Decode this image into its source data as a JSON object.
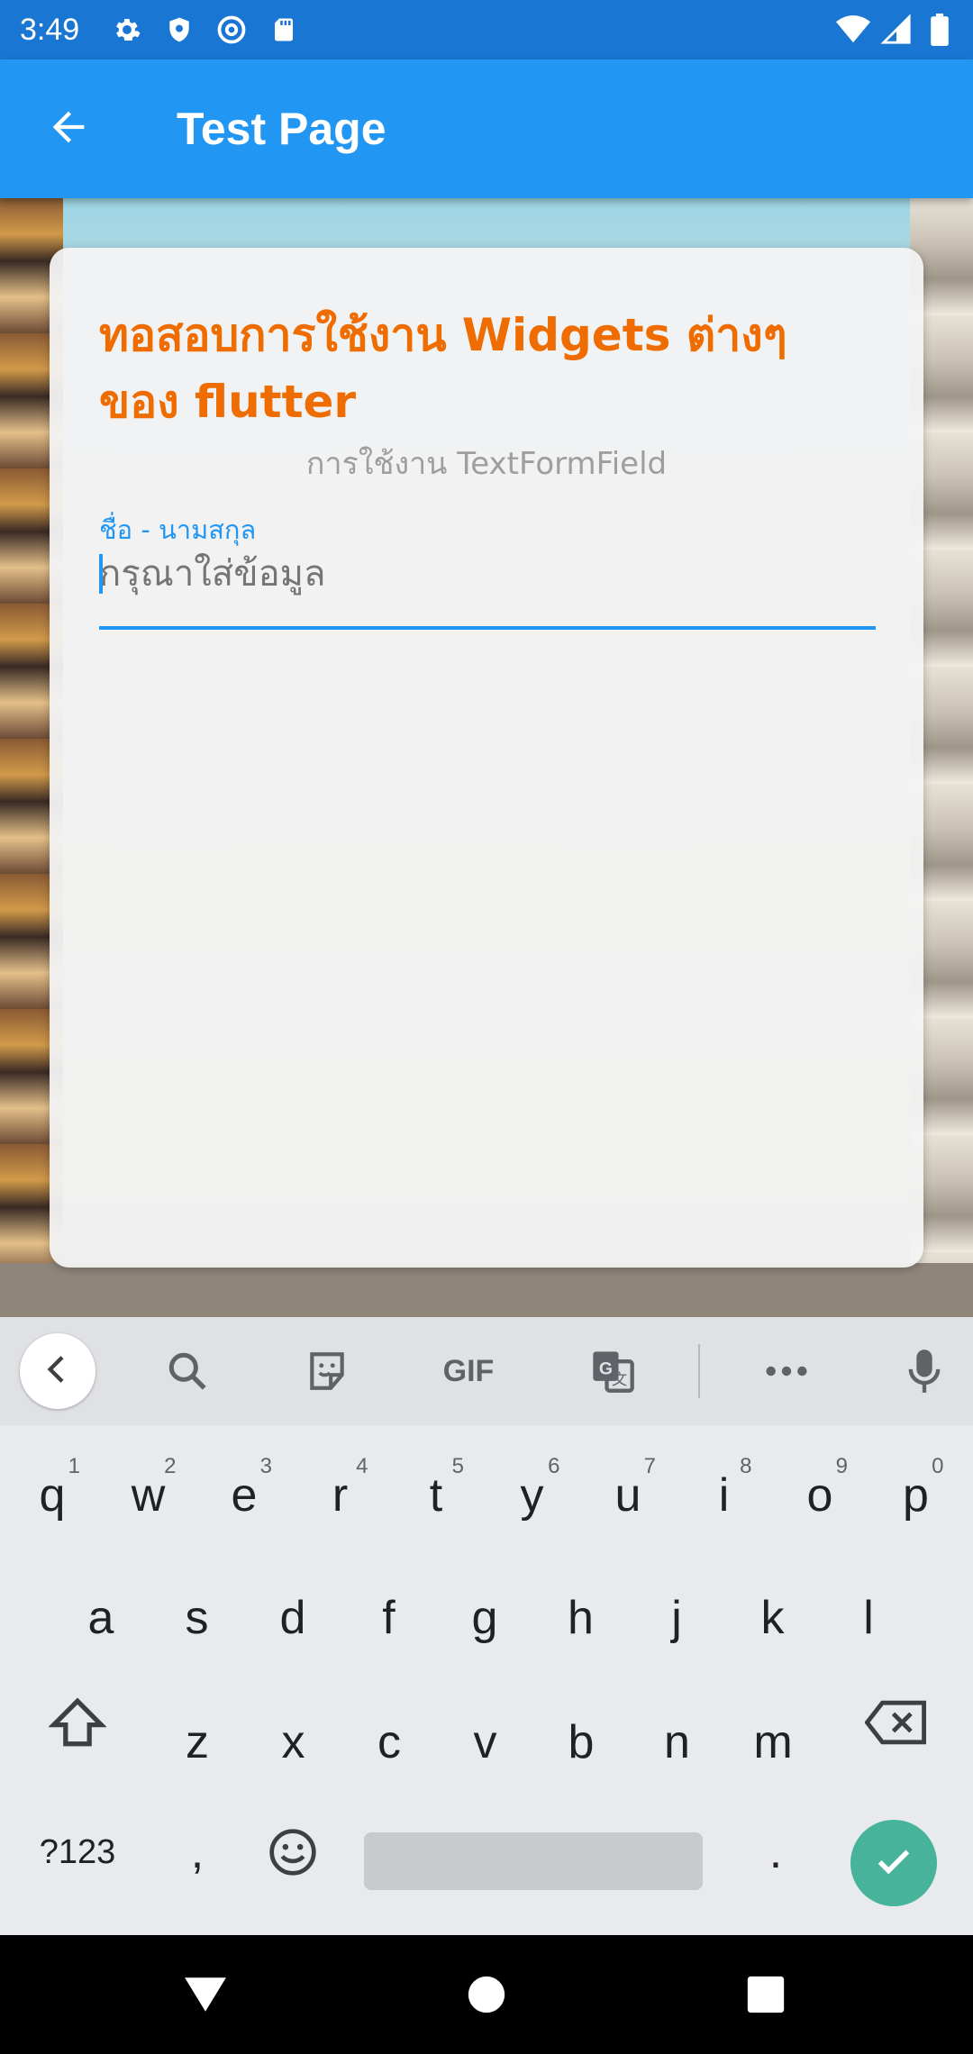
{
  "status_bar": {
    "time": "3:49",
    "left_icons": [
      "settings-icon",
      "shield-icon",
      "at-sign-icon",
      "sd-card-icon"
    ],
    "right_icons": [
      "wifi-icon",
      "signal-icon",
      "battery-icon"
    ]
  },
  "app_bar": {
    "title": "Test Page",
    "back_icon": "arrow-back-icon"
  },
  "card": {
    "title": "ทอสอบการใช้งาน Widgets ต่างๆ ของ flutter",
    "subtitle": "การใช้งาน TextFormField",
    "field": {
      "label": "ชื่อ - นามสกุล",
      "placeholder": "กรุณาใส่ข้อมูล",
      "value": ""
    }
  },
  "colors": {
    "status_bar": "#1976d2",
    "app_bar": "#2196f3",
    "title": "#ef6c00",
    "accent": "#2196f3",
    "enter_key": "#47b39b"
  },
  "keyboard": {
    "toolbar": [
      "collapse-icon",
      "search-icon",
      "sticker-icon",
      "gif-icon",
      "translate-icon",
      "more-icon",
      "mic-icon"
    ],
    "gif_label": "GIF",
    "row1": [
      {
        "k": "q",
        "n": "1"
      },
      {
        "k": "w",
        "n": "2"
      },
      {
        "k": "e",
        "n": "3"
      },
      {
        "k": "r",
        "n": "4"
      },
      {
        "k": "t",
        "n": "5"
      },
      {
        "k": "y",
        "n": "6"
      },
      {
        "k": "u",
        "n": "7"
      },
      {
        "k": "i",
        "n": "8"
      },
      {
        "k": "o",
        "n": "9"
      },
      {
        "k": "p",
        "n": "0"
      }
    ],
    "row2": [
      "a",
      "s",
      "d",
      "f",
      "g",
      "h",
      "j",
      "k",
      "l"
    ],
    "row3": [
      "z",
      "x",
      "c",
      "v",
      "b",
      "n",
      "m"
    ],
    "symbols_label": "?123",
    "comma": ",",
    "period": "."
  },
  "nav_bar": {
    "buttons": [
      "back-triangle-icon",
      "home-circle-icon",
      "recents-square-icon"
    ]
  }
}
